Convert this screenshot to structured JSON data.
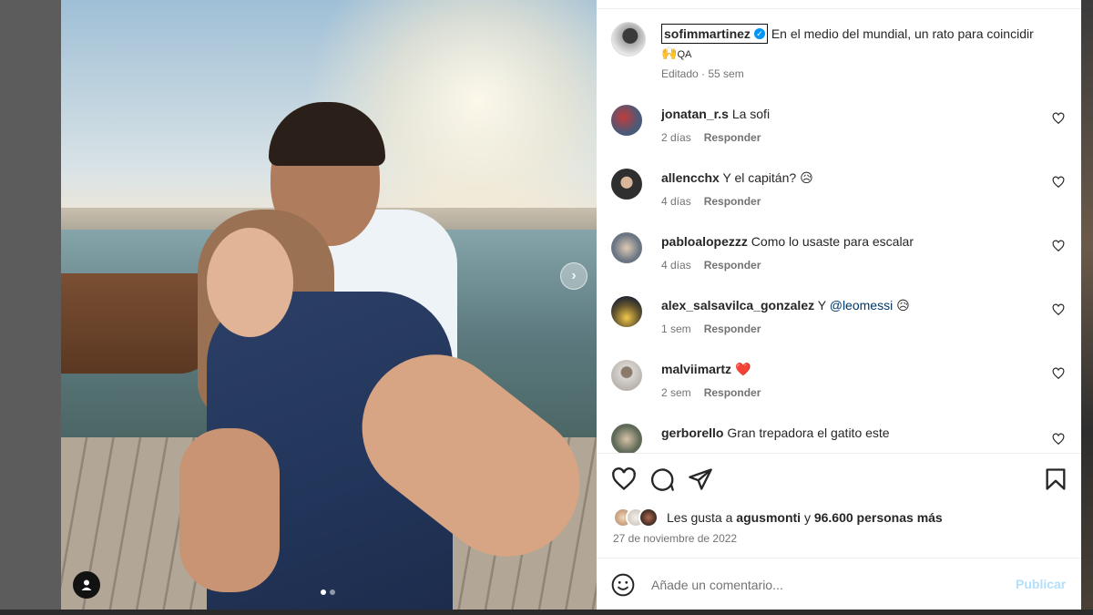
{
  "post": {
    "author": "sofimmartinez",
    "caption": "En el medio del mundial, un rato para coincidir",
    "caption_emoji": "🙌",
    "caption_location_tag": "QA",
    "edited_label": "Editado",
    "time_ago": "55 sem"
  },
  "comments": [
    {
      "user": "jonatan_r.s",
      "text": "La sofi",
      "time": "2 días",
      "reply_label": "Responder",
      "avatar_color": "#4a5a78"
    },
    {
      "user": "allencchx",
      "text": "Y el capitán?",
      "emoji": "😥",
      "time": "4 días",
      "reply_label": "Responder",
      "avatar_color": "#2f2f2f"
    },
    {
      "user": "pabloalopezzz",
      "text": "Como lo usaste para escalar",
      "time": "4 días",
      "reply_label": "Responder",
      "avatar_color": "#6a7684"
    },
    {
      "user": "alex_salsavilca_gonzalez",
      "text": "Y",
      "mention": "@leomessi",
      "emoji": "😥",
      "time": "1 sem",
      "reply_label": "Responder",
      "avatar_color": "#6b5a2e"
    },
    {
      "user": "malviimartz",
      "text": "",
      "emoji": "❤️",
      "time": "2 sem",
      "reply_label": "Responder",
      "avatar_color": "#b9b4ae"
    },
    {
      "user": "gerborello",
      "text": "Gran trepadora el gatito este",
      "avatar_color": "#5f6a58"
    }
  ],
  "likes": {
    "prefix": "Les gusta a",
    "first_user": "agusmonti",
    "connector": "y",
    "others": "96.600 personas más",
    "avatar_colors": [
      "#c9a27f",
      "#d8d0c8",
      "#4a3228"
    ]
  },
  "post_date": "27 de noviembre de 2022",
  "comment_box": {
    "placeholder": "Añade un comentario...",
    "publish_label": "Publicar"
  },
  "icons": {
    "like": "heart-icon",
    "comment": "comment-icon",
    "share": "paper-plane-icon",
    "save": "bookmark-icon",
    "emoji": "smiley-icon",
    "next": "chevron-right-icon",
    "tags": "user-tag-icon"
  },
  "colors": {
    "verified": "#0095f6",
    "heart_red": "#ed4956",
    "publish_disabled": "#b2dffc",
    "muted_text": "#737373"
  },
  "carousel": {
    "current": 1,
    "total": 2
  }
}
